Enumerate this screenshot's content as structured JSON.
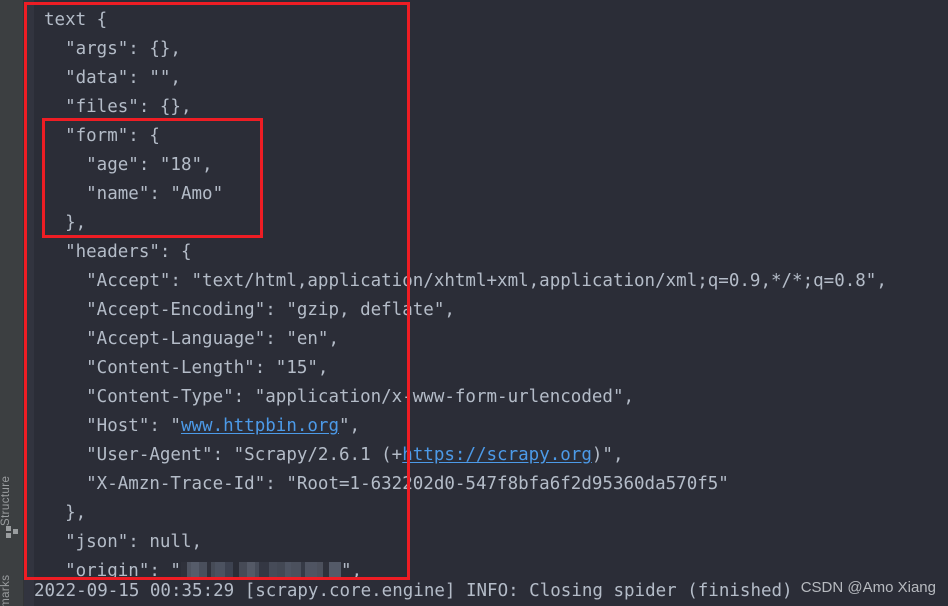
{
  "sidebar": {
    "tabs": [
      {
        "label": "Structure",
        "icon": "structure-icon"
      },
      {
        "label": "kmarks"
      }
    ]
  },
  "console": {
    "lines": [
      {
        "id": "l1",
        "indent": 0,
        "text": "text {"
      },
      {
        "id": "l2",
        "indent": 1,
        "text": "\"args\": {},"
      },
      {
        "id": "l3",
        "indent": 1,
        "text": "\"data\": \"\","
      },
      {
        "id": "l4",
        "indent": 1,
        "text": "\"files\": {},"
      },
      {
        "id": "l5",
        "indent": 1,
        "text": "\"form\": {"
      },
      {
        "id": "l6",
        "indent": 2,
        "text": "\"age\": \"18\","
      },
      {
        "id": "l7",
        "indent": 2,
        "text": "\"name\": \"Amo\""
      },
      {
        "id": "l8",
        "indent": 1,
        "text": "},"
      },
      {
        "id": "l9",
        "indent": 1,
        "text": "\"headers\": {"
      },
      {
        "id": "l10",
        "indent": 2,
        "text": "\"Accept\": \"text/html,application/xhtml+xml,application/xml;q=0.9,*/*;q=0.8\","
      },
      {
        "id": "l11",
        "indent": 2,
        "text": "\"Accept-Encoding\": \"gzip, deflate\","
      },
      {
        "id": "l12",
        "indent": 2,
        "text": "\"Accept-Language\": \"en\","
      },
      {
        "id": "l13",
        "indent": 2,
        "text": "\"Content-Length\": \"15\","
      },
      {
        "id": "l14",
        "indent": 2,
        "text": "\"Content-Type\": \"application/x-www-form-urlencoded\","
      },
      {
        "id": "l15",
        "indent": 2,
        "prefix": "\"Host\": \"",
        "link": "www.httpbin.org",
        "suffix": "\","
      },
      {
        "id": "l16",
        "indent": 2,
        "prefix": "\"User-Agent\": \"Scrapy/2.6.1 (+",
        "link": "https://scrapy.org",
        "suffix": ")\","
      },
      {
        "id": "l17",
        "indent": 2,
        "text": "\"X-Amzn-Trace-Id\": \"Root=1-632202d0-547f8bfa6f2d95360da570f5\""
      },
      {
        "id": "l18",
        "indent": 1,
        "text": "},"
      },
      {
        "id": "l19",
        "indent": 1,
        "text": "\"json\": null,"
      },
      {
        "id": "l20",
        "indent": 1,
        "prefix": "\"origin\": \"",
        "redacted": true,
        "suffix": "\","
      }
    ],
    "log": "2022-09-15 00:35:29 [scrapy.core.engine] INFO: Closing spider (finished)"
  },
  "annotations": {
    "outer_label": "json-response-highlight",
    "inner_label": "form-field-highlight",
    "color": "#ee1d24"
  },
  "watermark": "CSDN @Amo Xiang",
  "colors": {
    "editor_background": "#2b2d37",
    "sidebar_background": "#3c3f41",
    "text": "#b4bcc8",
    "link": "#4c9ae8",
    "annotation": "#ee1d24"
  }
}
